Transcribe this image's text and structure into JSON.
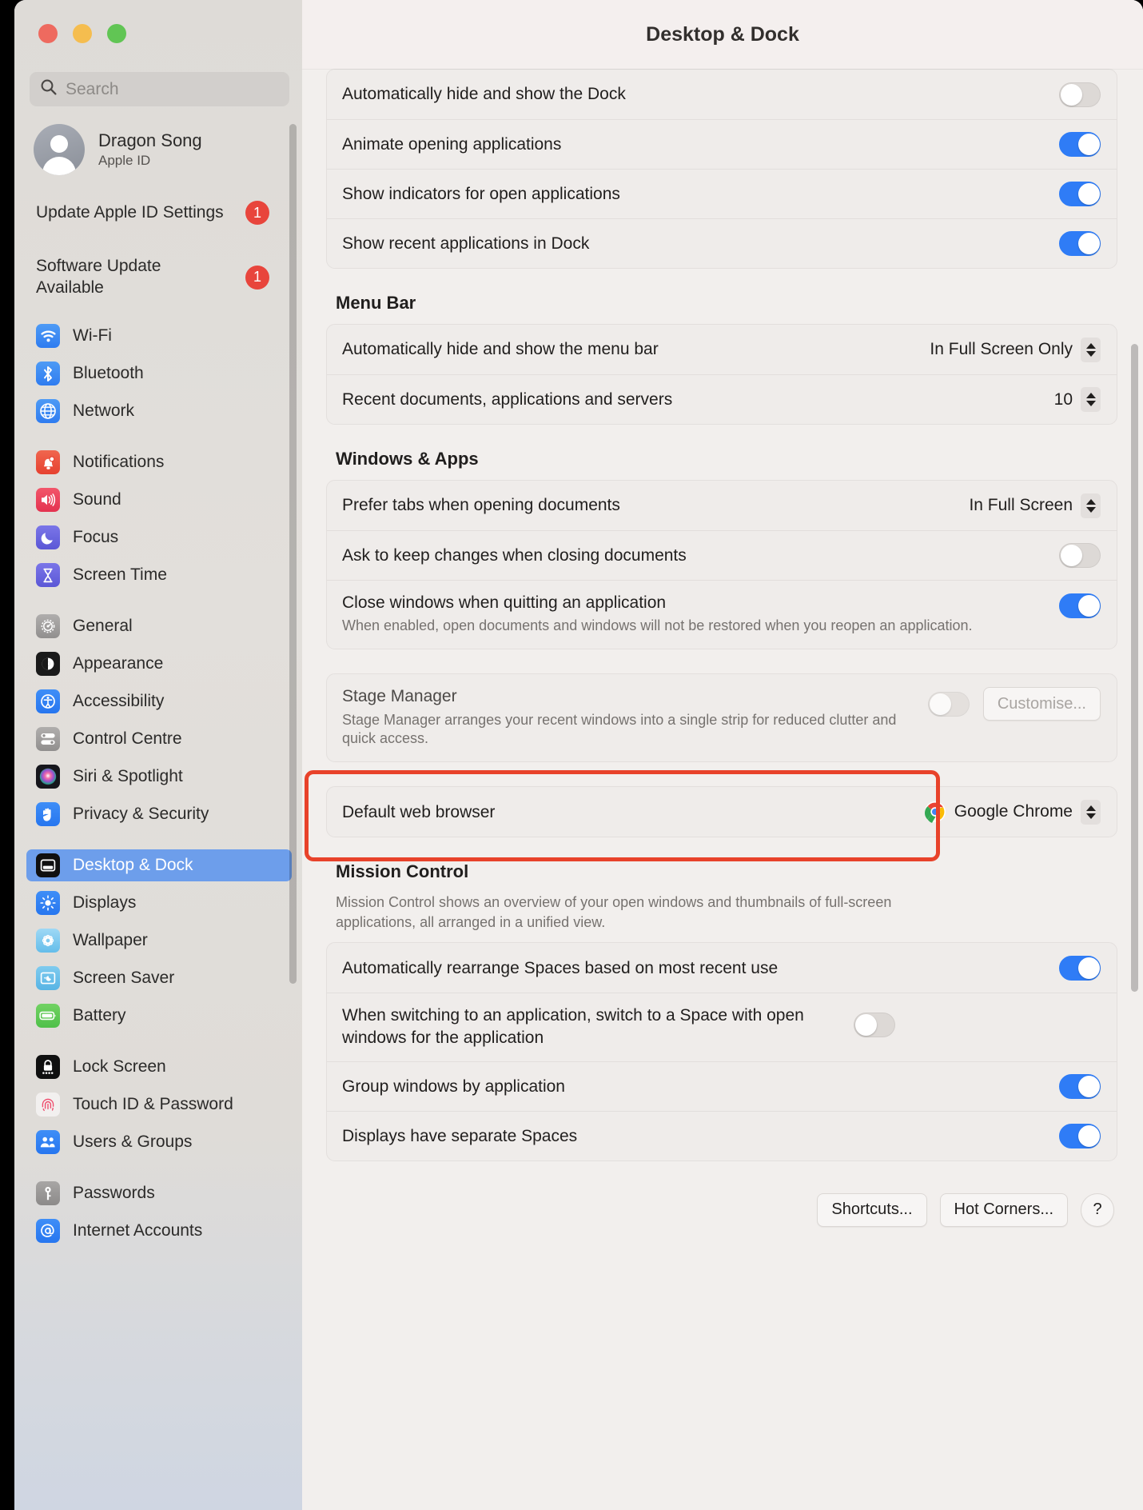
{
  "window": {
    "title": "Desktop & Dock",
    "traffic_lights": [
      "close",
      "minimise",
      "zoom"
    ]
  },
  "search": {
    "placeholder": "Search",
    "icon": "search-icon"
  },
  "account": {
    "name": "Dragon Song",
    "subtitle": "Apple ID",
    "avatar": "user-avatar-icon"
  },
  "notices": [
    {
      "text": "Update Apple ID Settings",
      "badge": "1"
    },
    {
      "text": "Software Update Available",
      "badge": "1"
    }
  ],
  "sidebar": {
    "groups": [
      {
        "items": [
          {
            "label": "Wi-Fi",
            "icon": "wifi-icon"
          },
          {
            "label": "Bluetooth",
            "icon": "bluetooth-icon"
          },
          {
            "label": "Network",
            "icon": "globe-icon"
          }
        ]
      },
      {
        "items": [
          {
            "label": "Notifications",
            "icon": "bell-icon"
          },
          {
            "label": "Sound",
            "icon": "speaker-icon"
          },
          {
            "label": "Focus",
            "icon": "moon-icon"
          },
          {
            "label": "Screen Time",
            "icon": "hourglass-icon"
          }
        ]
      },
      {
        "items": [
          {
            "label": "General",
            "icon": "gear-icon"
          },
          {
            "label": "Appearance",
            "icon": "appearance-icon"
          },
          {
            "label": "Accessibility",
            "icon": "accessibility-icon"
          },
          {
            "label": "Control Centre",
            "icon": "control-centre-icon"
          },
          {
            "label": "Siri & Spotlight",
            "icon": "siri-icon"
          },
          {
            "label": "Privacy & Security",
            "icon": "hand-icon"
          }
        ]
      },
      {
        "items": [
          {
            "label": "Desktop & Dock",
            "icon": "desktop-dock-icon",
            "selected": true
          },
          {
            "label": "Displays",
            "icon": "brightness-icon"
          },
          {
            "label": "Wallpaper",
            "icon": "wallpaper-icon"
          },
          {
            "label": "Screen Saver",
            "icon": "screen-saver-icon"
          },
          {
            "label": "Battery",
            "icon": "battery-icon"
          }
        ]
      },
      {
        "items": [
          {
            "label": "Lock Screen",
            "icon": "lock-icon"
          },
          {
            "label": "Touch ID & Password",
            "icon": "fingerprint-icon"
          },
          {
            "label": "Users & Groups",
            "icon": "users-icon"
          }
        ]
      },
      {
        "items": [
          {
            "label": "Passwords",
            "icon": "key-icon"
          },
          {
            "label": "Internet Accounts",
            "icon": "at-sign-icon"
          }
        ]
      }
    ]
  },
  "main": {
    "dock_rows": [
      {
        "label": "Automatically hide and show the Dock",
        "control": "toggle",
        "state": "off"
      },
      {
        "label": "Animate opening applications",
        "control": "toggle",
        "state": "on"
      },
      {
        "label": "Show indicators for open applications",
        "control": "toggle",
        "state": "on"
      },
      {
        "label": "Show recent applications in Dock",
        "control": "toggle",
        "state": "on"
      }
    ],
    "menu_bar": {
      "heading": "Menu Bar",
      "rows": [
        {
          "label": "Automatically hide and show the menu bar",
          "control": "popup",
          "value": "In Full Screen Only"
        },
        {
          "label": "Recent documents, applications and servers",
          "control": "popup",
          "value": "10"
        }
      ]
    },
    "windows_apps": {
      "heading": "Windows & Apps",
      "rows": [
        {
          "label": "Prefer tabs when opening documents",
          "control": "popup",
          "value": "In Full Screen"
        },
        {
          "label": "Ask to keep changes when closing documents",
          "control": "toggle",
          "state": "off"
        },
        {
          "label": "Close windows when quitting an application",
          "sub": "When enabled, open documents and windows will not be restored when you reopen an application.",
          "control": "toggle",
          "state": "on"
        }
      ],
      "stage_manager": {
        "label": "Stage Manager",
        "sub": "Stage Manager arranges your recent windows into a single strip for reduced clutter and quick access.",
        "state": "off",
        "button": "Customise..."
      },
      "default_browser": {
        "label": "Default web browser",
        "value": "Google Chrome",
        "icon": "chrome-icon"
      }
    },
    "mission_control": {
      "heading": "Mission Control",
      "description": "Mission Control shows an overview of your open windows and thumbnails of full-screen applications, all arranged in a unified view.",
      "rows": [
        {
          "label": "Automatically rearrange Spaces based on most recent use",
          "control": "toggle",
          "state": "on"
        },
        {
          "label": "When switching to an application, switch to a Space with open windows for the application",
          "control": "toggle",
          "state": "off"
        },
        {
          "label": "Group windows by application",
          "control": "toggle",
          "state": "on"
        },
        {
          "label": "Displays have separate Spaces",
          "control": "toggle",
          "state": "on"
        }
      ]
    },
    "footer_buttons": [
      {
        "label": "Shortcuts..."
      },
      {
        "label": "Hot Corners..."
      },
      {
        "label": "?"
      }
    ]
  },
  "annotation": {
    "color": "#e8422a",
    "target": "default-web-browser-row"
  }
}
